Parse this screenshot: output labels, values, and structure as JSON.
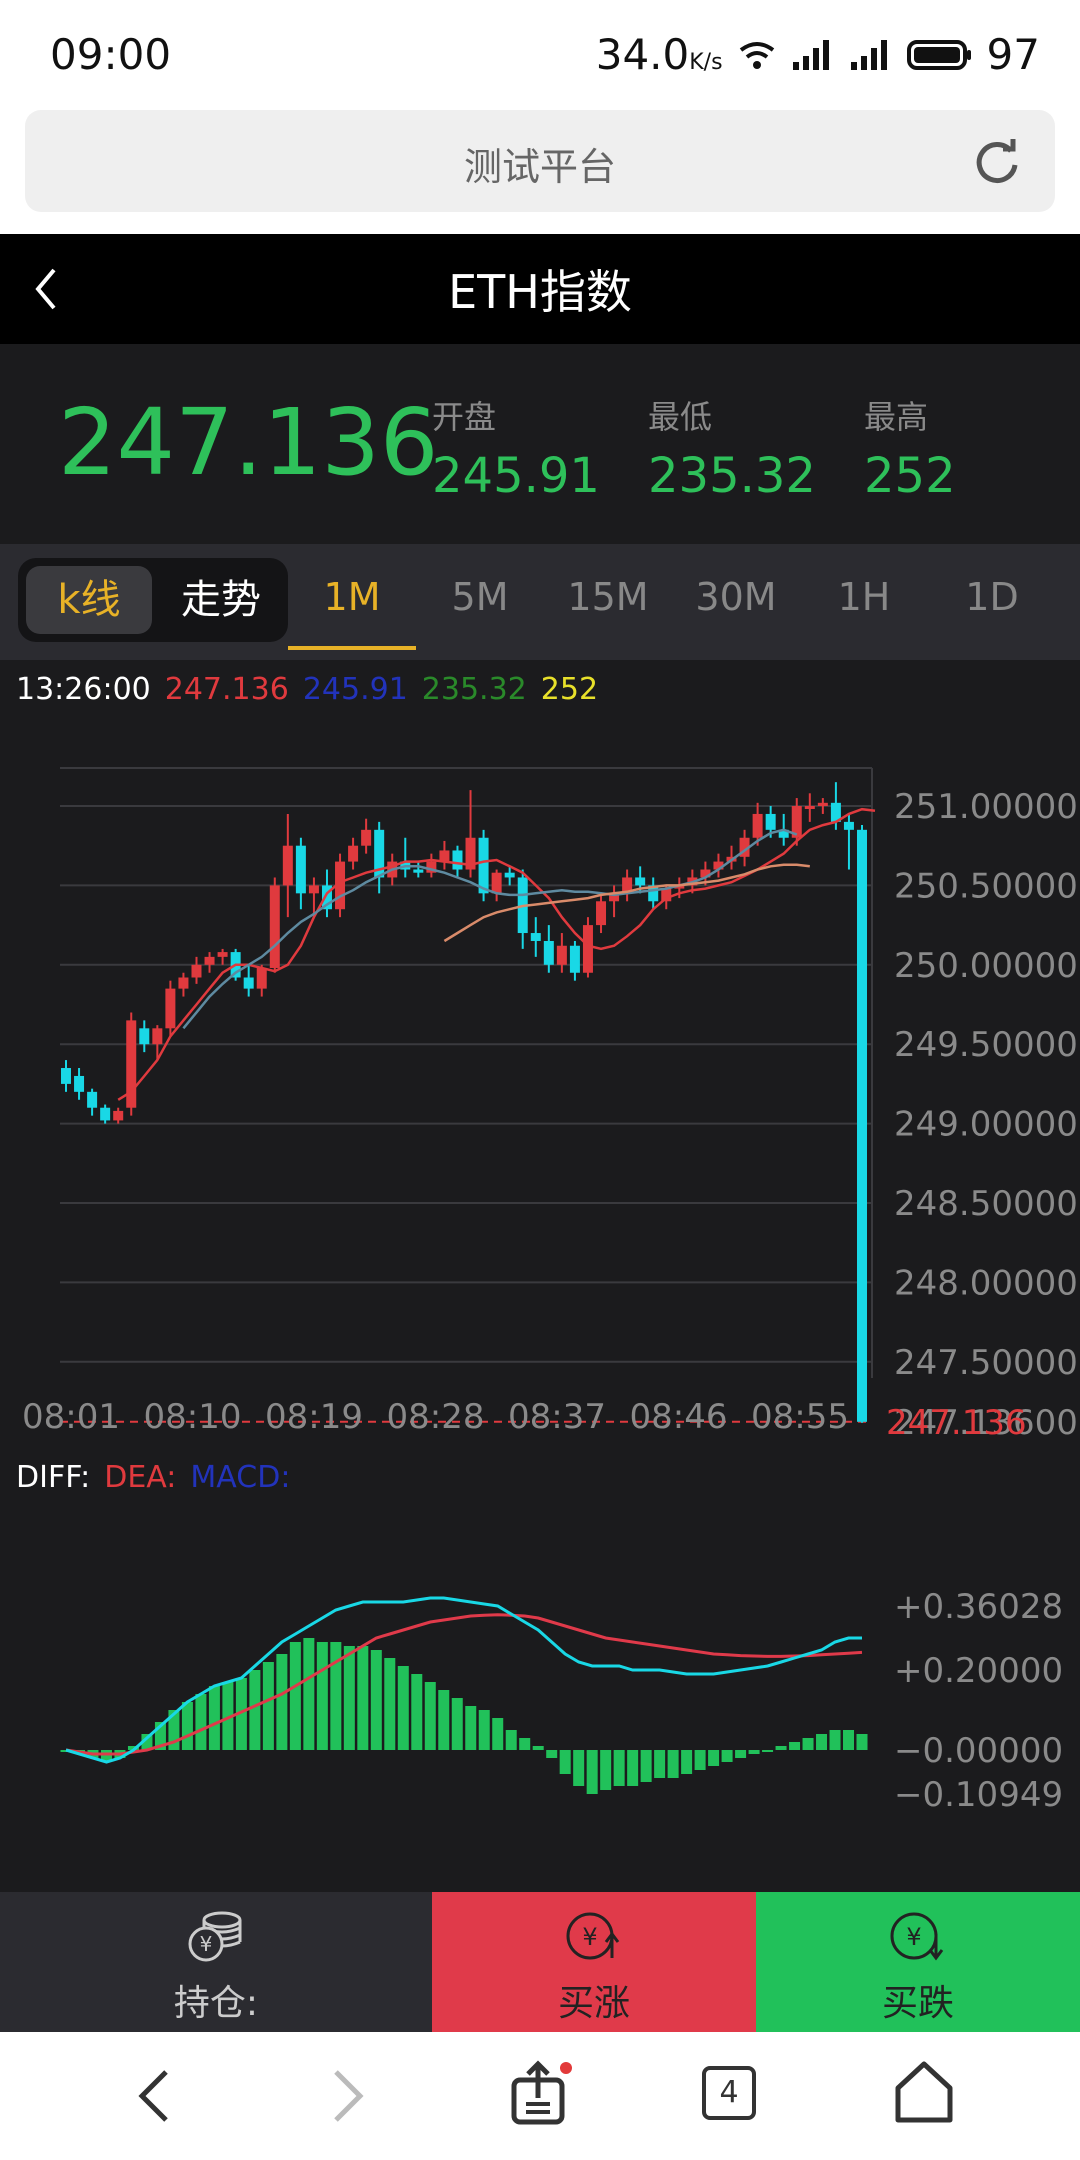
{
  "status_bar": {
    "time": "09:00",
    "speed": "34.0",
    "speed_unit": "K/s",
    "battery": "97"
  },
  "browser": {
    "title": "测试平台"
  },
  "header": {
    "title": "ETH指数"
  },
  "price": {
    "current": "247.136",
    "open_label": "开盘",
    "open": "245.91",
    "low_label": "最低",
    "low": "235.32",
    "high_label": "最高",
    "high": "252"
  },
  "mode": {
    "kline": "k线",
    "trend": "走势"
  },
  "timeframes": [
    "1M",
    "5M",
    "15M",
    "30M",
    "1H",
    "1D"
  ],
  "active_timeframe": "1M",
  "info": {
    "time": "13:26:00",
    "v1": "247.136",
    "v2": "245.91",
    "v3": "235.32",
    "v4": "252"
  },
  "macd_labels": {
    "diff": "DIFF:",
    "dea": "DEA:",
    "macd": "MACD:"
  },
  "actions": {
    "position": "持仓:",
    "buy_up": "买涨",
    "buy_down": "买跌"
  },
  "nav": {
    "tab_count": "4"
  },
  "colors": {
    "up": "#e03a3e",
    "down": "#19d8e6",
    "green": "#21c15a",
    "accent": "#e8b227"
  },
  "chart_data": [
    {
      "type": "candlestick",
      "y_tick_labels": [
        "251.00000",
        "250.50000",
        "250.00000",
        "249.50000",
        "249.00000",
        "248.50000",
        "248.00000",
        "247.50000",
        "247.13600"
      ],
      "y_ticks": [
        251.0,
        250.5,
        250.0,
        249.5,
        249.0,
        248.5,
        248.0,
        247.5,
        247.136
      ],
      "ylim": [
        247.136,
        251.0
      ],
      "x_tick_labels": [
        "08:01",
        "08:10",
        "08:19",
        "08:28",
        "08:37",
        "08:46",
        "08:55"
      ],
      "last_price_label": "247.136",
      "candles": [
        [
          249.35,
          249.4,
          249.2,
          249.25
        ],
        [
          249.3,
          249.35,
          249.15,
          249.2
        ],
        [
          249.2,
          249.22,
          249.05,
          249.1
        ],
        [
          249.1,
          249.12,
          249.0,
          249.02
        ],
        [
          249.02,
          249.1,
          249.0,
          249.08
        ],
        [
          249.1,
          249.7,
          249.05,
          249.65
        ],
        [
          249.6,
          249.65,
          249.45,
          249.5
        ],
        [
          249.5,
          249.62,
          249.4,
          249.6
        ],
        [
          249.6,
          249.9,
          249.55,
          249.85
        ],
        [
          249.85,
          249.95,
          249.8,
          249.92
        ],
        [
          249.92,
          250.05,
          249.88,
          250.0
        ],
        [
          250.0,
          250.08,
          249.95,
          250.05
        ],
        [
          250.05,
          250.1,
          250.0,
          250.08
        ],
        [
          250.08,
          250.1,
          249.9,
          249.92
        ],
        [
          249.92,
          250.0,
          249.8,
          249.85
        ],
        [
          249.85,
          250.0,
          249.8,
          249.98
        ],
        [
          249.98,
          250.55,
          249.95,
          250.5
        ],
        [
          250.5,
          250.95,
          250.3,
          250.75
        ],
        [
          250.75,
          250.8,
          250.35,
          250.45
        ],
        [
          250.45,
          250.55,
          250.3,
          250.5
        ],
        [
          250.5,
          250.6,
          250.3,
          250.35
        ],
        [
          250.35,
          250.7,
          250.3,
          250.65
        ],
        [
          250.65,
          250.8,
          250.6,
          250.75
        ],
        [
          250.75,
          250.92,
          250.7,
          250.85
        ],
        [
          250.85,
          250.9,
          250.45,
          250.55
        ],
        [
          250.55,
          250.7,
          250.5,
          250.65
        ],
        [
          250.65,
          250.8,
          250.55,
          250.6
        ],
        [
          250.6,
          250.65,
          250.55,
          250.58
        ],
        [
          250.58,
          250.7,
          250.55,
          250.65
        ],
        [
          250.65,
          250.78,
          250.6,
          250.72
        ],
        [
          250.72,
          250.75,
          250.55,
          250.6
        ],
        [
          250.6,
          251.1,
          250.55,
          250.8
        ],
        [
          250.8,
          250.85,
          250.4,
          250.45
        ],
        [
          250.45,
          250.6,
          250.4,
          250.58
        ],
        [
          250.58,
          250.62,
          250.5,
          250.55
        ],
        [
          250.55,
          250.6,
          250.1,
          250.2
        ],
        [
          250.2,
          250.3,
          250.05,
          250.15
        ],
        [
          250.15,
          250.25,
          249.95,
          250.0
        ],
        [
          250.0,
          250.2,
          249.95,
          250.12
        ],
        [
          250.12,
          250.15,
          249.9,
          249.95
        ],
        [
          249.95,
          250.3,
          249.92,
          250.25
        ],
        [
          250.25,
          250.45,
          250.2,
          250.4
        ],
        [
          250.4,
          250.5,
          250.3,
          250.45
        ],
        [
          250.45,
          250.6,
          250.4,
          250.55
        ],
        [
          250.55,
          250.62,
          250.45,
          250.5
        ],
        [
          250.5,
          250.55,
          250.35,
          250.4
        ],
        [
          250.4,
          250.5,
          250.35,
          250.48
        ],
        [
          250.48,
          250.55,
          250.42,
          250.5
        ],
        [
          250.5,
          250.6,
          250.45,
          250.55
        ],
        [
          250.55,
          250.65,
          250.5,
          250.6
        ],
        [
          250.6,
          250.7,
          250.55,
          250.65
        ],
        [
          250.65,
          250.75,
          250.6,
          250.68
        ],
        [
          250.68,
          250.85,
          250.62,
          250.8
        ],
        [
          250.8,
          251.02,
          250.75,
          250.95
        ],
        [
          250.95,
          251.0,
          250.8,
          250.85
        ],
        [
          250.85,
          250.95,
          250.75,
          250.8
        ],
        [
          250.8,
          251.05,
          250.75,
          251.0
        ],
        [
          251.0,
          251.08,
          250.9,
          251.0
        ],
        [
          251.0,
          251.05,
          250.95,
          251.02
        ],
        [
          251.02,
          251.15,
          250.85,
          250.9
        ],
        [
          250.9,
          250.95,
          250.6,
          250.85
        ],
        [
          250.85,
          250.88,
          247.13,
          247.136
        ]
      ],
      "ma_series": [
        {
          "color": "#e03a3e",
          "start": 4,
          "values": [
            249.15,
            249.2,
            249.3,
            249.4,
            249.55,
            249.65,
            249.75,
            249.85,
            249.95,
            250.0,
            250.0,
            249.98,
            249.96,
            250.0,
            250.12,
            250.3,
            250.45,
            250.52,
            250.55,
            250.58,
            250.6,
            250.62,
            250.65,
            250.65,
            250.66,
            250.65,
            250.64,
            250.63,
            250.65,
            250.66,
            250.62,
            250.58,
            250.5,
            250.42,
            250.3,
            250.2,
            250.12,
            250.1,
            250.12,
            250.18,
            250.25,
            250.35,
            250.42,
            250.45,
            250.47,
            250.48,
            250.5,
            250.52,
            250.56,
            250.6,
            250.65,
            250.7,
            250.78,
            250.85,
            250.88,
            250.9,
            250.95,
            250.98,
            250.97
          ]
        },
        {
          "color": "#5e8aa0",
          "start": 9,
          "values": [
            249.6,
            249.7,
            249.8,
            249.88,
            249.95,
            250.0,
            250.05,
            250.12,
            250.2,
            250.27,
            250.32,
            250.38,
            250.43,
            250.47,
            250.52,
            250.56,
            250.6,
            250.62,
            250.62,
            250.6,
            250.58,
            250.55,
            250.52,
            250.48,
            250.45,
            250.44,
            250.44,
            250.45,
            250.46,
            250.47,
            250.46,
            250.46,
            250.45,
            250.44,
            250.45,
            250.46,
            250.47,
            250.48,
            250.5,
            250.52,
            250.55,
            250.6,
            250.66,
            250.72,
            250.78,
            250.83,
            250.85,
            250.82
          ]
        },
        {
          "color": "#d98b6a",
          "start": 29,
          "values": [
            250.15,
            250.2,
            250.25,
            250.3,
            250.33,
            250.35,
            250.37,
            250.38,
            250.39,
            250.4,
            250.41,
            250.42,
            250.44,
            250.45,
            250.46,
            250.48,
            250.49,
            250.5,
            250.5,
            250.51,
            250.52,
            250.53,
            250.55,
            250.57,
            250.6,
            250.62,
            250.63,
            250.63,
            250.62
          ]
        }
      ]
    },
    {
      "type": "bar",
      "name": "MACD",
      "y_tick_labels": [
        "+0.36028",
        "+0.20000",
        "−0.00000",
        "−0.10949"
      ],
      "y_ticks": [
        0.36028,
        0.2,
        0.0,
        -0.10949
      ],
      "ylim": [
        -0.10949,
        0.36028
      ],
      "histogram": [
        0.0,
        -0.01,
        -0.02,
        -0.03,
        -0.02,
        0.01,
        0.04,
        0.07,
        0.1,
        0.12,
        0.14,
        0.16,
        0.17,
        0.18,
        0.2,
        0.22,
        0.24,
        0.27,
        0.28,
        0.27,
        0.27,
        0.26,
        0.26,
        0.25,
        0.23,
        0.21,
        0.19,
        0.17,
        0.15,
        0.13,
        0.11,
        0.1,
        0.08,
        0.05,
        0.03,
        0.01,
        -0.02,
        -0.06,
        -0.09,
        -0.11,
        -0.1,
        -0.09,
        -0.09,
        -0.08,
        -0.07,
        -0.07,
        -0.06,
        -0.05,
        -0.04,
        -0.03,
        -0.02,
        -0.01,
        0.0,
        0.01,
        0.02,
        0.03,
        0.04,
        0.05,
        0.05,
        0.04
      ],
      "diff": [
        0.0,
        -0.01,
        -0.02,
        -0.03,
        -0.02,
        0.0,
        0.03,
        0.06,
        0.09,
        0.12,
        0.14,
        0.16,
        0.17,
        0.18,
        0.21,
        0.24,
        0.27,
        0.29,
        0.31,
        0.33,
        0.35,
        0.36,
        0.37,
        0.37,
        0.37,
        0.37,
        0.375,
        0.38,
        0.38,
        0.375,
        0.37,
        0.365,
        0.36,
        0.34,
        0.32,
        0.3,
        0.27,
        0.24,
        0.22,
        0.21,
        0.21,
        0.21,
        0.2,
        0.2,
        0.2,
        0.195,
        0.19,
        0.19,
        0.19,
        0.195,
        0.2,
        0.205,
        0.21,
        0.22,
        0.23,
        0.24,
        0.25,
        0.27,
        0.28,
        0.28
      ],
      "dea": [
        0.0,
        -0.005,
        -0.01,
        -0.01,
        -0.01,
        -0.005,
        0.0,
        0.01,
        0.02,
        0.035,
        0.05,
        0.065,
        0.08,
        0.095,
        0.11,
        0.125,
        0.14,
        0.16,
        0.18,
        0.2,
        0.22,
        0.24,
        0.26,
        0.28,
        0.29,
        0.3,
        0.31,
        0.32,
        0.325,
        0.33,
        0.335,
        0.337,
        0.338,
        0.337,
        0.335,
        0.33,
        0.32,
        0.31,
        0.3,
        0.29,
        0.28,
        0.275,
        0.27,
        0.265,
        0.26,
        0.255,
        0.25,
        0.245,
        0.24,
        0.238,
        0.236,
        0.235,
        0.234,
        0.234,
        0.235,
        0.236,
        0.238,
        0.24,
        0.242,
        0.244
      ]
    }
  ]
}
